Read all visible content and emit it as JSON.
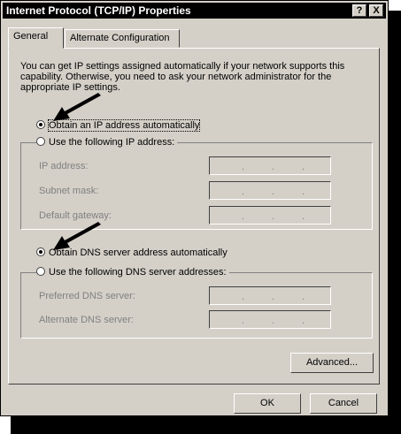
{
  "window": {
    "title": "Internet Protocol (TCP/IP) Properties",
    "help_button": "?",
    "close_button": "X"
  },
  "tabs": [
    {
      "label": "General"
    },
    {
      "label": "Alternate Configuration"
    }
  ],
  "description": "You can get IP settings assigned automatically if your network supports this capability. Otherwise, you need to ask your network administrator for the appropriate IP settings.",
  "ip": {
    "auto_label": "Obtain an IP address automatically",
    "manual_label": "Use the following IP address:",
    "auto_selected": true,
    "fields": [
      {
        "label": "IP address:"
      },
      {
        "label": "Subnet mask:"
      },
      {
        "label": "Default gateway:"
      }
    ]
  },
  "dns": {
    "auto_label": "Obtain DNS server address automatically",
    "manual_label": "Use the following DNS server addresses:",
    "auto_selected": true,
    "fields": [
      {
        "label": "Preferred DNS server:"
      },
      {
        "label": "Alternate DNS server:"
      }
    ]
  },
  "buttons": {
    "advanced": "Advanced...",
    "ok": "OK",
    "cancel": "Cancel"
  }
}
